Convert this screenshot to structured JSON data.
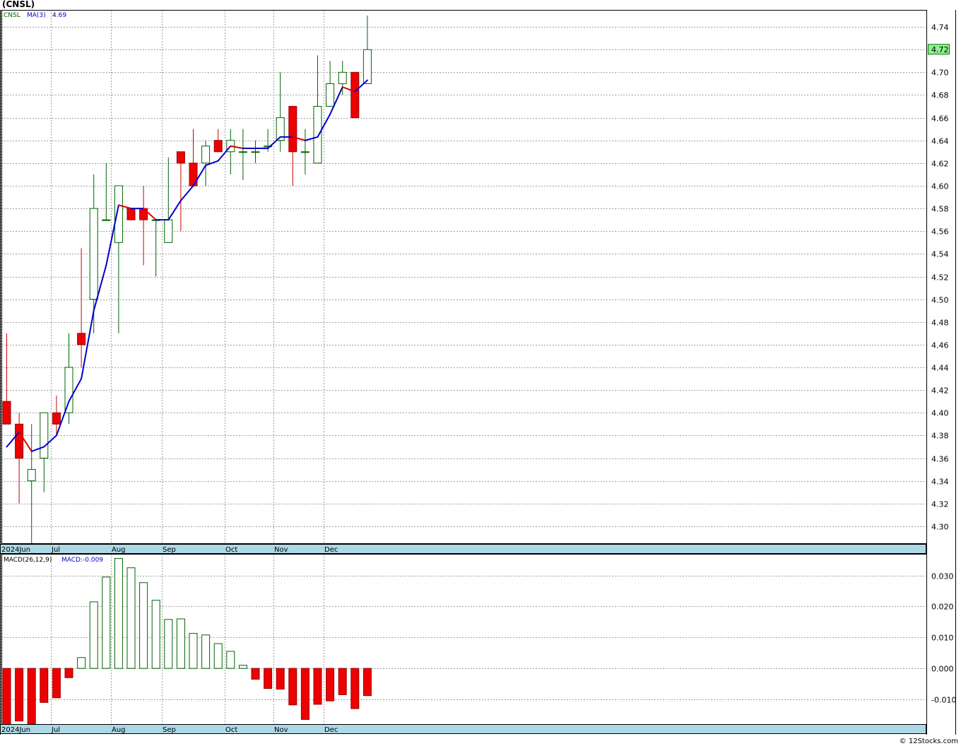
{
  "header": {
    "title": "(CNSL)",
    "footer": "© 12Stocks.com"
  },
  "chart_data": [
    {
      "type": "candlestick",
      "symbol": "CNSL",
      "legend": {
        "symbol_label": "CNSL",
        "ma_label": "MA(3)",
        "ma_value": "4.69"
      },
      "last_price_label": "4.72",
      "x_labels": [
        "2024Jun",
        "Jul",
        "Aug",
        "Sep",
        "Oct",
        "Nov",
        "Dec"
      ],
      "ylim": [
        4.285,
        4.755
      ],
      "y_ticks": [
        "4.30",
        "4.32",
        "4.34",
        "4.36",
        "4.38",
        "4.40",
        "4.42",
        "4.44",
        "4.46",
        "4.48",
        "4.50",
        "4.52",
        "4.54",
        "4.56",
        "4.58",
        "4.60",
        "4.62",
        "4.64",
        "4.66",
        "4.68",
        "4.70",
        "4.72",
        "4.74"
      ],
      "colors": {
        "up": "#006400",
        "down": "#cc0000",
        "down_fill": "#ee0000",
        "ma_up": "#0000cc",
        "ma_down": "#dd0000"
      },
      "candles": [
        {
          "open": 4.41,
          "high": 4.47,
          "low": 4.39,
          "close": 4.39
        },
        {
          "open": 4.39,
          "high": 4.4,
          "low": 4.32,
          "close": 4.36
        },
        {
          "open": 4.34,
          "high": 4.39,
          "low": 4.28,
          "close": 4.35
        },
        {
          "open": 4.36,
          "high": 4.4,
          "low": 4.33,
          "close": 4.4
        },
        {
          "open": 4.4,
          "high": 4.415,
          "low": 4.38,
          "close": 4.39
        },
        {
          "open": 4.4,
          "high": 4.47,
          "low": 4.39,
          "close": 4.44
        },
        {
          "open": 4.47,
          "high": 4.545,
          "low": 4.44,
          "close": 4.46
        },
        {
          "open": 4.5,
          "high": 4.61,
          "low": 4.47,
          "close": 4.58
        },
        {
          "open": 4.57,
          "high": 4.62,
          "low": 4.57,
          "close": 4.57
        },
        {
          "open": 4.55,
          "high": 4.6,
          "low": 4.47,
          "close": 4.6
        },
        {
          "open": 4.58,
          "high": 4.58,
          "low": 4.57,
          "close": 4.57
        },
        {
          "open": 4.58,
          "high": 4.6,
          "low": 4.53,
          "close": 4.57
        },
        {
          "open": 4.57,
          "high": 4.57,
          "low": 4.52,
          "close": 4.57
        },
        {
          "open": 4.55,
          "high": 4.625,
          "low": 4.55,
          "close": 4.57
        },
        {
          "open": 4.63,
          "high": 4.63,
          "low": 4.56,
          "close": 4.62
        },
        {
          "open": 4.62,
          "high": 4.65,
          "low": 4.6,
          "close": 4.6
        },
        {
          "open": 4.62,
          "high": 4.64,
          "low": 4.6,
          "close": 4.635
        },
        {
          "open": 4.64,
          "high": 4.65,
          "low": 4.63,
          "close": 4.63
        },
        {
          "open": 4.63,
          "high": 4.65,
          "low": 4.61,
          "close": 4.64
        },
        {
          "open": 4.63,
          "high": 4.65,
          "low": 4.605,
          "close": 4.63
        },
        {
          "open": 4.63,
          "high": 4.64,
          "low": 4.62,
          "close": 4.63
        },
        {
          "open": 4.635,
          "high": 4.65,
          "low": 4.63,
          "close": 4.635
        },
        {
          "open": 4.64,
          "high": 4.7,
          "low": 4.63,
          "close": 4.66
        },
        {
          "open": 4.67,
          "high": 4.67,
          "low": 4.6,
          "close": 4.63
        },
        {
          "open": 4.63,
          "high": 4.65,
          "low": 4.61,
          "close": 4.63
        },
        {
          "open": 4.62,
          "high": 4.715,
          "low": 4.62,
          "close": 4.67
        },
        {
          "open": 4.67,
          "high": 4.71,
          "low": 4.67,
          "close": 4.69
        },
        {
          "open": 4.69,
          "high": 4.71,
          "low": 4.68,
          "close": 4.7
        },
        {
          "open": 4.7,
          "high": 4.7,
          "low": 4.66,
          "close": 4.66
        },
        {
          "open": 4.69,
          "high": 4.75,
          "low": 4.69,
          "close": 4.72
        }
      ],
      "ma": [
        4.37,
        4.383,
        4.366,
        4.37,
        4.38,
        4.41,
        4.43,
        4.49,
        4.53,
        4.583,
        4.58,
        4.58,
        4.57,
        4.57,
        4.587,
        4.6,
        4.618,
        4.622,
        4.635,
        4.633,
        4.633,
        4.633,
        4.643,
        4.643,
        4.64,
        4.643,
        4.663,
        4.687,
        4.683,
        4.693
      ]
    },
    {
      "type": "bar",
      "name": "MACD(26,12,9)",
      "legend": {
        "label": "MACD(26,12,9)",
        "value_label": "MACD:-0.009"
      },
      "x_labels": [
        "2024Jun",
        "Jul",
        "Aug",
        "Sep",
        "Oct",
        "Nov",
        "Dec"
      ],
      "ylim": [
        -0.018,
        0.037
      ],
      "y_ticks": [
        "0.030",
        "0.020",
        "0.010",
        "0.000",
        "-0.010"
      ],
      "values": [
        -0.019,
        -0.017,
        -0.018,
        -0.011,
        -0.0095,
        -0.003,
        0.0035,
        0.0215,
        0.0295,
        0.0355,
        0.0325,
        0.0277,
        0.022,
        0.0158,
        0.016,
        0.0113,
        0.0108,
        0.008,
        0.0055,
        0.001,
        -0.0035,
        -0.0065,
        -0.0067,
        -0.0118,
        -0.0165,
        -0.0116,
        -0.0105,
        -0.0085,
        -0.013,
        -0.0088
      ]
    }
  ]
}
